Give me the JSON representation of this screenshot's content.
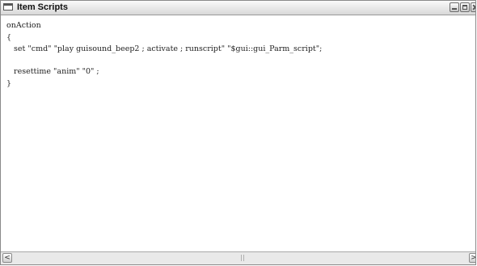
{
  "window": {
    "title": "Item Scripts",
    "icon": "window-icon",
    "buttons": [
      "minimize-icon",
      "maximize-icon",
      "close-icon"
    ]
  },
  "editor": {
    "lines": [
      "onAction",
      "{",
      "   set \"cmd\" \"play guisound_beep2 ; activate ; runscript\" \"$gui::gui_Parm_script\";",
      "",
      "   resettime \"anim\" \"0\" ;",
      "}"
    ]
  },
  "scrollbar": {
    "left_arrow": "<",
    "right_arrow": ">",
    "grip": "│"
  },
  "colors": {
    "titlebar": "#e4e4e4",
    "text": "#222222",
    "background": "#ffffff"
  }
}
